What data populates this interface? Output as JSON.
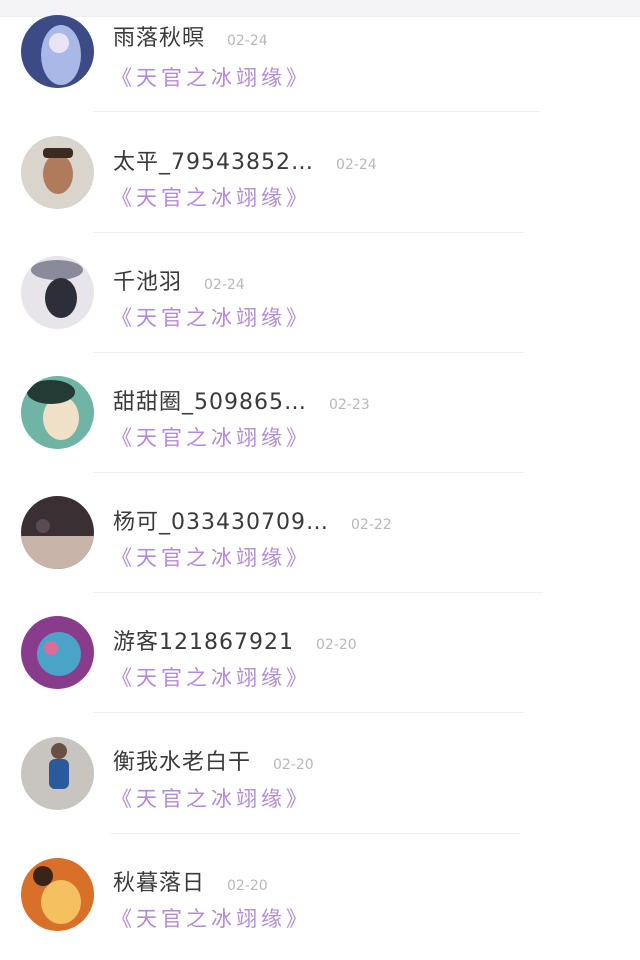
{
  "comments": [
    {
      "username": "雨落秋暝",
      "date": "02-24",
      "book_title": "《天官之冰翊缘》",
      "avatar_colors": [
        "#3c4a86",
        "#a9b8e6",
        "#e8e4f4"
      ]
    },
    {
      "username": "太平_79543852…",
      "date": "02-24",
      "book_title": "《天官之冰翊缘》",
      "avatar_colors": [
        "#d9d4cc",
        "#b07a5c",
        "#3a2a20"
      ]
    },
    {
      "username": "千池羽",
      "date": "02-24",
      "book_title": "《天官之冰翊缘》",
      "avatar_colors": [
        "#e7e4ea",
        "#8a8a9a",
        "#2e2e38"
      ]
    },
    {
      "username": "甜甜圈_509865…",
      "date": "02-23",
      "book_title": "《天官之冰翊缘》",
      "avatar_colors": [
        "#6fb4a4",
        "#f0e0c8",
        "#243a34"
      ]
    },
    {
      "username": "杨可_033430709…",
      "date": "02-22",
      "book_title": "《天官之冰翊缘》",
      "avatar_colors": [
        "#3a3034",
        "#c8b4a8",
        "#5a4a52"
      ]
    },
    {
      "username": "游客121867921",
      "date": "02-20",
      "book_title": "《天官之冰翊缘》",
      "avatar_colors": [
        "#8a3c8c",
        "#4aa4c8",
        "#e06a9a"
      ]
    },
    {
      "username": "衡我水老白干",
      "date": "02-20",
      "book_title": "《天官之冰翊缘》",
      "avatar_colors": [
        "#c8c4c0",
        "#2a5a9a",
        "#6a5040"
      ]
    },
    {
      "username": "秋暮落日",
      "date": "02-20",
      "book_title": "《天官之冰翊缘》",
      "avatar_colors": [
        "#d8702a",
        "#f4c060",
        "#3a2418"
      ]
    }
  ]
}
